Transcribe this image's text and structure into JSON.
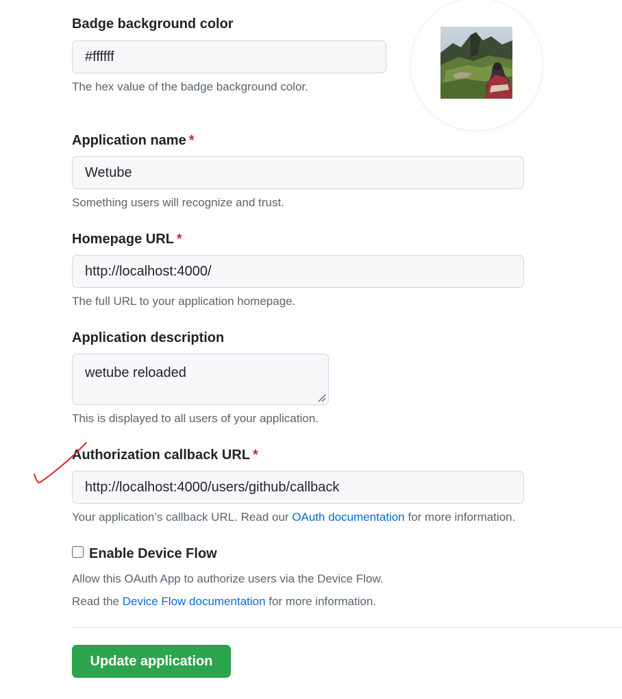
{
  "badge_color": {
    "label": "Badge background color",
    "value": "#ffffff",
    "note": "The hex value of the badge background color."
  },
  "app_name": {
    "label": "Application name",
    "required_mark": "*",
    "value": "Wetube",
    "note": "Something users will recognize and trust."
  },
  "homepage_url": {
    "label": "Homepage URL",
    "required_mark": "*",
    "value": "http://localhost:4000/",
    "note": "The full URL to your application homepage."
  },
  "description": {
    "label": "Application description",
    "value": "wetube reloaded",
    "note": "This is displayed to all users of your application."
  },
  "callback_url": {
    "label": "Authorization callback URL",
    "required_mark": "*",
    "value": "http://localhost:4000/users/github/callback",
    "note_prefix": "Your application’s callback URL. Read our ",
    "note_link": "OAuth documentation",
    "note_suffix": " for more information."
  },
  "device_flow": {
    "label": "Enable Device Flow",
    "checked": false,
    "note_line1": "Allow this OAuth App to authorize users via the Device Flow.",
    "note_line2_prefix": "Read the ",
    "note_line2_link": "Device Flow documentation",
    "note_line2_suffix": " for more information."
  },
  "submit": {
    "label": "Update application"
  },
  "annotation": {
    "icon": "checkmark-annotation-icon",
    "color": "#e0202a"
  },
  "colors": {
    "accent_link": "#0969da",
    "primary_button": "#2da44e",
    "required": "#cf222e"
  }
}
